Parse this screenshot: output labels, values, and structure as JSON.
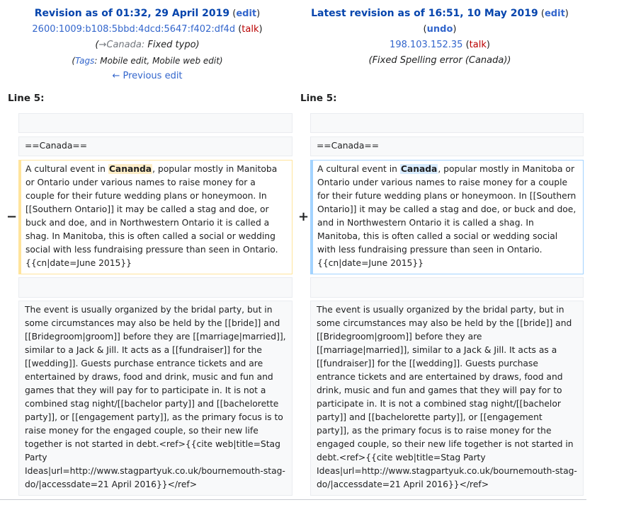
{
  "left_header": {
    "title": "Revision as of 01:32, 29 April 2019",
    "edit_label": "edit",
    "user": "2600:1009:b108:5bbd:4dcd:5647:f402:df4d",
    "talk_label": "talk",
    "summary_section": "→Canada:",
    "summary_text": "Fixed typo",
    "tags_label": "Tags",
    "tags_text": "Mobile edit, Mobile web edit",
    "prev_link": "← Previous edit"
  },
  "right_header": {
    "title": "Latest revision as of 16:51, 10 May 2019",
    "edit_label": "edit",
    "undo_label": "undo",
    "user": "198.103.152.35",
    "talk_label": "talk",
    "summary_text": "(Fixed Spelling error (Canada))"
  },
  "line_label_left": "Line 5:",
  "line_label_right": "Line 5:",
  "markers": {
    "minus": "−",
    "plus": "+"
  },
  "diff": {
    "context_heading": "==Canada==",
    "left_changed": {
      "before": "A cultural event in ",
      "word": "Cananda",
      "after": ", popular mostly in Manitoba or Ontario under various names to raise money for a couple for their future wedding plans or honeymoon. In [[Southern Ontario]] it may be called a stag and doe, or buck and doe, and in Northwestern Ontario it is called a shag. In Manitoba, this is often called a social or wedding social with less fundraising pressure than seen in Ontario.{{cn|date=June 2015}}"
    },
    "right_changed": {
      "before": "A cultural event in ",
      "word": "Canada",
      "after": ", popular mostly in Manitoba or Ontario under various names to raise money for a couple for their future wedding plans or honeymoon. In [[Southern Ontario]] it may be called a stag and doe, or buck and doe, and in Northwestern Ontario it is called a shag. In Manitoba, this is often called a social or wedding social with less fundraising pressure than seen in Ontario.{{cn|date=June 2015}}"
    },
    "context_paragraph": "The event is usually organized by the bridal party, but in some circumstances may also be held by the [[bride]] and [[Bridegroom|groom]] before they are [[marriage|married]], similar to a Jack & Jill. It acts as a [[fundraiser]] for the [[wedding]]. Guests purchase entrance tickets and are entertained by draws, food and drink, music and fun and games that they will pay for to participate in. It is not a combined stag night/[[bachelor party]] and [[bachelorette party]], or [[engagement party]], as the primary focus is to raise money for the engaged couple, so their new life together is not started in debt.<ref>{{cite web|title=Stag Party Ideas|url=http://www.stagpartyuk.co.uk/bournemouth-stag-do/|accessdate=21 April 2016}}</ref>"
  }
}
